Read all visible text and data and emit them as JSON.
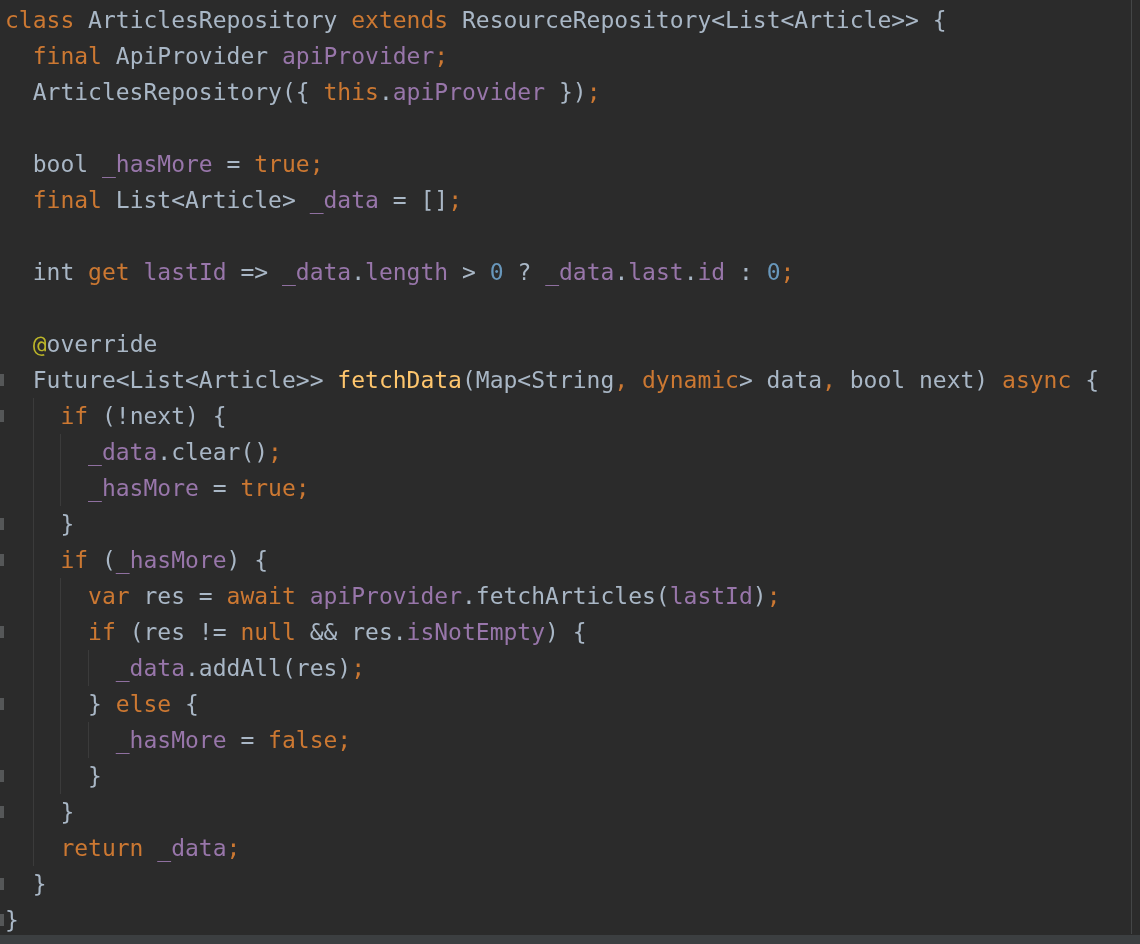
{
  "editor": {
    "lines": [
      {
        "kind": "code",
        "fold": false,
        "tokens": [
          {
            "kind": "kw",
            "t": "class"
          },
          {
            "kind": "plain",
            "t": " ArticlesRepository "
          },
          {
            "kind": "kw",
            "t": "extends"
          },
          {
            "kind": "plain",
            "t": " ResourceRepository<List<Article>> {"
          }
        ]
      },
      {
        "kind": "code",
        "fold": false,
        "tokens": [
          {
            "kind": "kw",
            "t": "  final"
          },
          {
            "kind": "plain",
            "t": " ApiProvider "
          },
          {
            "kind": "field",
            "t": "apiProvider"
          },
          {
            "kind": "kw",
            "t": ";"
          }
        ]
      },
      {
        "kind": "code",
        "fold": false,
        "tokens": [
          {
            "kind": "plain",
            "t": "  ArticlesRepository({ "
          },
          {
            "kind": "kw",
            "t": "this"
          },
          {
            "kind": "plain",
            "t": "."
          },
          {
            "kind": "field",
            "t": "apiProvider"
          },
          {
            "kind": "plain",
            "t": " })"
          },
          {
            "kind": "kw",
            "t": ";"
          }
        ]
      },
      {
        "kind": "blank"
      },
      {
        "kind": "code",
        "fold": false,
        "tokens": [
          {
            "kind": "plain",
            "t": "  bool "
          },
          {
            "kind": "field",
            "t": "_hasMore"
          },
          {
            "kind": "plain",
            "t": " = "
          },
          {
            "kind": "kw",
            "t": "true;"
          }
        ]
      },
      {
        "kind": "code",
        "fold": false,
        "tokens": [
          {
            "kind": "kw",
            "t": "  final"
          },
          {
            "kind": "plain",
            "t": " List<Article> "
          },
          {
            "kind": "field",
            "t": "_data"
          },
          {
            "kind": "plain",
            "t": " = []"
          },
          {
            "kind": "kw",
            "t": ";"
          }
        ]
      },
      {
        "kind": "blank"
      },
      {
        "kind": "code",
        "fold": false,
        "tokens": [
          {
            "kind": "plain",
            "t": "  int "
          },
          {
            "kind": "kw",
            "t": "get"
          },
          {
            "kind": "field",
            "t": " lastId"
          },
          {
            "kind": "plain",
            "t": " => "
          },
          {
            "kind": "field",
            "t": "_data"
          },
          {
            "kind": "plain",
            "t": "."
          },
          {
            "kind": "field",
            "t": "length"
          },
          {
            "kind": "plain",
            "t": " > "
          },
          {
            "kind": "num",
            "t": "0"
          },
          {
            "kind": "plain",
            "t": " ? "
          },
          {
            "kind": "field",
            "t": "_data"
          },
          {
            "kind": "plain",
            "t": "."
          },
          {
            "kind": "field",
            "t": "last"
          },
          {
            "kind": "plain",
            "t": "."
          },
          {
            "kind": "field",
            "t": "id"
          },
          {
            "kind": "plain",
            "t": " : "
          },
          {
            "kind": "num",
            "t": "0"
          },
          {
            "kind": "kw",
            "t": ";"
          }
        ]
      },
      {
        "kind": "blank"
      },
      {
        "kind": "code",
        "fold": false,
        "tokens": [
          {
            "kind": "annot",
            "t": "  @"
          },
          {
            "kind": "plain",
            "t": "override"
          }
        ]
      },
      {
        "kind": "code",
        "fold": true,
        "tokens": [
          {
            "kind": "plain",
            "t": "  Future<List<Article>> "
          },
          {
            "kind": "fn",
            "t": "fetchData"
          },
          {
            "kind": "plain",
            "t": "(Map<String"
          },
          {
            "kind": "kw",
            "t": ", dynamic"
          },
          {
            "kind": "plain",
            "t": "> data"
          },
          {
            "kind": "kw",
            "t": ","
          },
          {
            "kind": "plain",
            "t": " bool next) "
          },
          {
            "kind": "kw",
            "t": "async"
          },
          {
            "kind": "plain",
            "t": " {"
          }
        ]
      },
      {
        "kind": "code",
        "fold": true,
        "tokens": [
          {
            "kind": "kw",
            "t": "    if"
          },
          {
            "kind": "plain",
            "t": " (!next) {"
          }
        ]
      },
      {
        "kind": "code",
        "fold": false,
        "tokens": [
          {
            "kind": "field",
            "t": "      _data"
          },
          {
            "kind": "plain",
            "t": ".clear()"
          },
          {
            "kind": "kw",
            "t": ";"
          }
        ]
      },
      {
        "kind": "code",
        "fold": false,
        "tokens": [
          {
            "kind": "field",
            "t": "      _hasMore"
          },
          {
            "kind": "plain",
            "t": " = "
          },
          {
            "kind": "kw",
            "t": "true;"
          }
        ]
      },
      {
        "kind": "code",
        "fold": true,
        "tokens": [
          {
            "kind": "plain",
            "t": "    }"
          }
        ]
      },
      {
        "kind": "code",
        "fold": true,
        "tokens": [
          {
            "kind": "kw",
            "t": "    if"
          },
          {
            "kind": "plain",
            "t": " ("
          },
          {
            "kind": "field",
            "t": "_hasMore"
          },
          {
            "kind": "plain",
            "t": ") {"
          }
        ]
      },
      {
        "kind": "code",
        "fold": false,
        "tokens": [
          {
            "kind": "kw",
            "t": "      var"
          },
          {
            "kind": "plain",
            "t": " res = "
          },
          {
            "kind": "kw",
            "t": "await"
          },
          {
            "kind": "field",
            "t": " apiProvider"
          },
          {
            "kind": "plain",
            "t": ".fetchArticles("
          },
          {
            "kind": "field",
            "t": "lastId"
          },
          {
            "kind": "plain",
            "t": ")"
          },
          {
            "kind": "kw",
            "t": ";"
          }
        ]
      },
      {
        "kind": "code",
        "fold": true,
        "tokens": [
          {
            "kind": "kw",
            "t": "      if"
          },
          {
            "kind": "plain",
            "t": " (res != "
          },
          {
            "kind": "kw",
            "t": "null"
          },
          {
            "kind": "plain",
            "t": " && res."
          },
          {
            "kind": "field",
            "t": "isNotEmpty"
          },
          {
            "kind": "plain",
            "t": ") {"
          }
        ]
      },
      {
        "kind": "code",
        "fold": false,
        "tokens": [
          {
            "kind": "field",
            "t": "        _data"
          },
          {
            "kind": "plain",
            "t": ".addAll(res)"
          },
          {
            "kind": "kw",
            "t": ";"
          }
        ]
      },
      {
        "kind": "code",
        "fold": true,
        "tokens": [
          {
            "kind": "plain",
            "t": "      } "
          },
          {
            "kind": "kw",
            "t": "else"
          },
          {
            "kind": "plain",
            "t": " {"
          }
        ]
      },
      {
        "kind": "code",
        "fold": false,
        "tokens": [
          {
            "kind": "field",
            "t": "        _hasMore"
          },
          {
            "kind": "plain",
            "t": " = "
          },
          {
            "kind": "kw",
            "t": "false;"
          }
        ]
      },
      {
        "kind": "code",
        "fold": true,
        "tokens": [
          {
            "kind": "plain",
            "t": "      }"
          }
        ]
      },
      {
        "kind": "code",
        "fold": true,
        "tokens": [
          {
            "kind": "plain",
            "t": "    }"
          }
        ]
      },
      {
        "kind": "code",
        "fold": false,
        "tokens": [
          {
            "kind": "kw",
            "t": "    return"
          },
          {
            "kind": "field",
            "t": " _data"
          },
          {
            "kind": "kw",
            "t": ";"
          }
        ]
      },
      {
        "kind": "code",
        "fold": true,
        "tokens": [
          {
            "kind": "plain",
            "t": "  }"
          }
        ]
      },
      {
        "kind": "code",
        "fold": true,
        "tokens": [
          {
            "kind": "plain",
            "t": "}"
          }
        ]
      }
    ]
  }
}
